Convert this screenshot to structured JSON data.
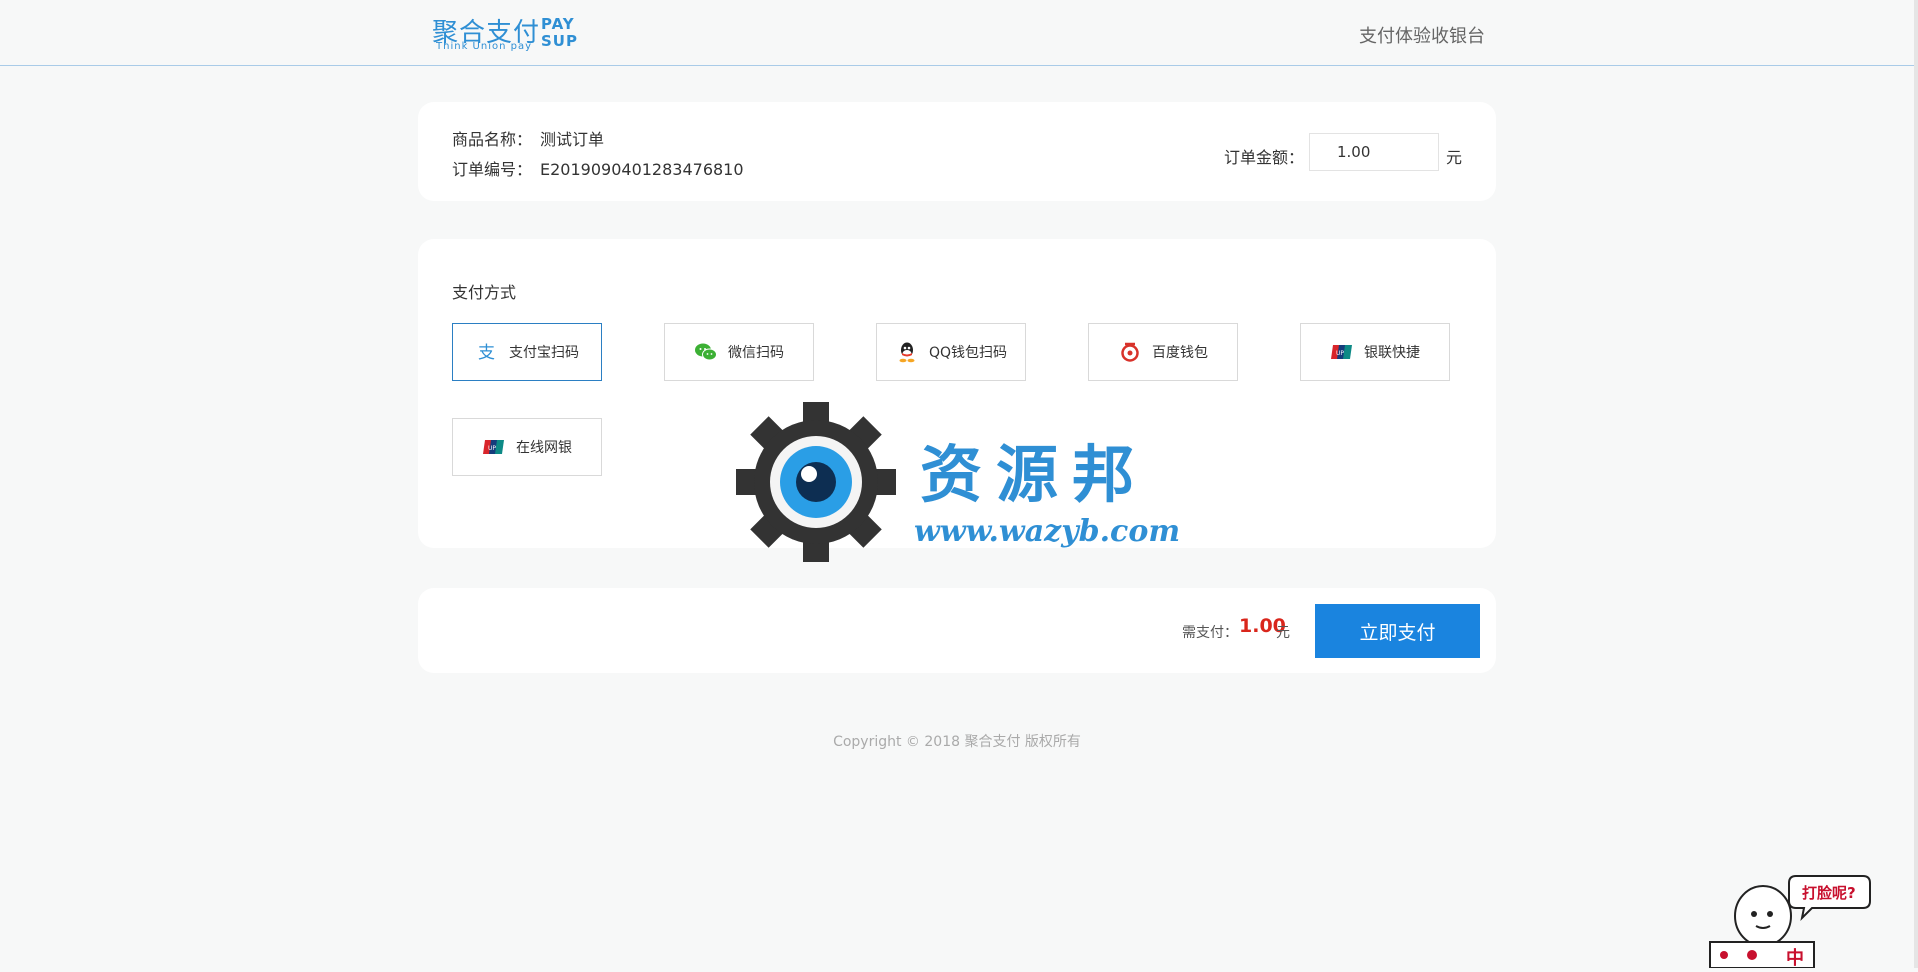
{
  "header": {
    "logo_cn": "聚合支付",
    "logo_en": "Think Union pay",
    "logo_pay": "PAY",
    "logo_sup": "SUP",
    "title": "支付体验收银台"
  },
  "order": {
    "name_label": "商品名称：",
    "name_value": "测试订单",
    "number_label": "订单编号：",
    "number_value": "E2019090401283476810",
    "amount_label": "订单金额：",
    "amount_value": "1.00",
    "amount_unit": "元"
  },
  "payment": {
    "section_title": "支付方式",
    "methods": [
      {
        "label": "支付宝扫码",
        "icon": "alipay-icon",
        "selected": true
      },
      {
        "label": "微信扫码",
        "icon": "wechat-icon",
        "selected": false
      },
      {
        "label": "QQ钱包扫码",
        "icon": "qq-icon",
        "selected": false
      },
      {
        "label": "百度钱包",
        "icon": "baidu-wallet-icon",
        "selected": false
      },
      {
        "label": "银联快捷",
        "icon": "unionpay-icon",
        "selected": false
      },
      {
        "label": "在线网银",
        "icon": "unionpay-icon",
        "selected": false
      }
    ]
  },
  "watermark": {
    "title": "资源邦",
    "url": "www.wazyb.com"
  },
  "summary": {
    "need_label": "需支付：",
    "need_amount": "1.00",
    "need_unit": "元",
    "pay_button": "立即支付"
  },
  "footer": {
    "copyright": "Copyright © 2018 聚合支付 版权所有"
  },
  "mascot": {
    "bubble": "打脸呢?",
    "sign": "中"
  },
  "colors": {
    "brand": "#2f8fd4",
    "button": "#1a84df",
    "price": "#d9261c",
    "selected_border": "#2b7fc3"
  }
}
